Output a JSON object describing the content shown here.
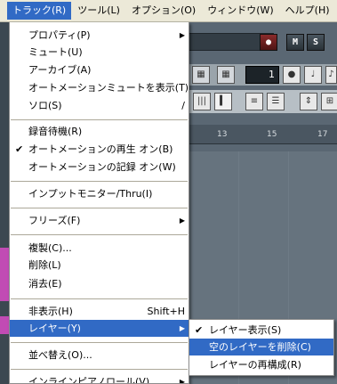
{
  "menubar": {
    "items": [
      {
        "label": "トラック(R)"
      },
      {
        "label": "ツール(L)"
      },
      {
        "label": "オプション(O)"
      },
      {
        "label": "ウィンドウ(W)"
      },
      {
        "label": "ヘルプ(H)"
      }
    ]
  },
  "menu": {
    "items": [
      {
        "label": "プロパティ(P)",
        "has_submenu": true
      },
      {
        "label": "ミュート(U)"
      },
      {
        "label": "アーカイブ(A)"
      },
      {
        "label": "オートメーションミュートを表示(T)"
      },
      {
        "label": "ソロ(S)",
        "shortcut": "/"
      },
      {
        "label": "録音待機(R)"
      },
      {
        "label": "オートメーションの再生 オン(B)",
        "checked": true
      },
      {
        "label": "オートメーションの記録 オン(W)"
      },
      {
        "label": "インプットモニター/Thru(I)"
      },
      {
        "label": "フリーズ(F)",
        "has_submenu": true
      },
      {
        "label": "複製(C)..."
      },
      {
        "label": "削除(L)"
      },
      {
        "label": "消去(E)"
      },
      {
        "label": "非表示(H)",
        "shortcut": "Shift+H"
      },
      {
        "label": "レイヤー(Y)",
        "has_submenu": true,
        "highlighted": true
      },
      {
        "label": "並べ替え(O)..."
      },
      {
        "label": "インラインピアノロール(V)",
        "has_submenu": true
      }
    ],
    "check_glyph": "✔",
    "arrow_glyph": "▶"
  },
  "submenu": {
    "items": [
      {
        "label": "レイヤー表示(S)",
        "checked": true
      },
      {
        "label": "空のレイヤーを削除(C)",
        "highlighted": true
      },
      {
        "label": "レイヤーの再構成(R)"
      }
    ]
  },
  "background": {
    "track_buttons": {
      "record": "●",
      "mute": "M",
      "solo": "S"
    },
    "dropdown_arrow": "⌄",
    "counter_value": "1",
    "ruler_labels": [
      "13",
      "15",
      "17"
    ],
    "tool_icons": [
      "grid-icon",
      "grid-icon",
      "note-icon",
      "note-icon",
      "note-icon",
      "bars-icon",
      "snap-icon",
      "eq-icon",
      "list-icon",
      "fit-icon",
      "zoom-icon"
    ]
  },
  "colors": {
    "highlight": "#316ac5",
    "menubar": "#ece9d8",
    "background": "#5a6773",
    "clip_magenta": "#c14bb4"
  }
}
